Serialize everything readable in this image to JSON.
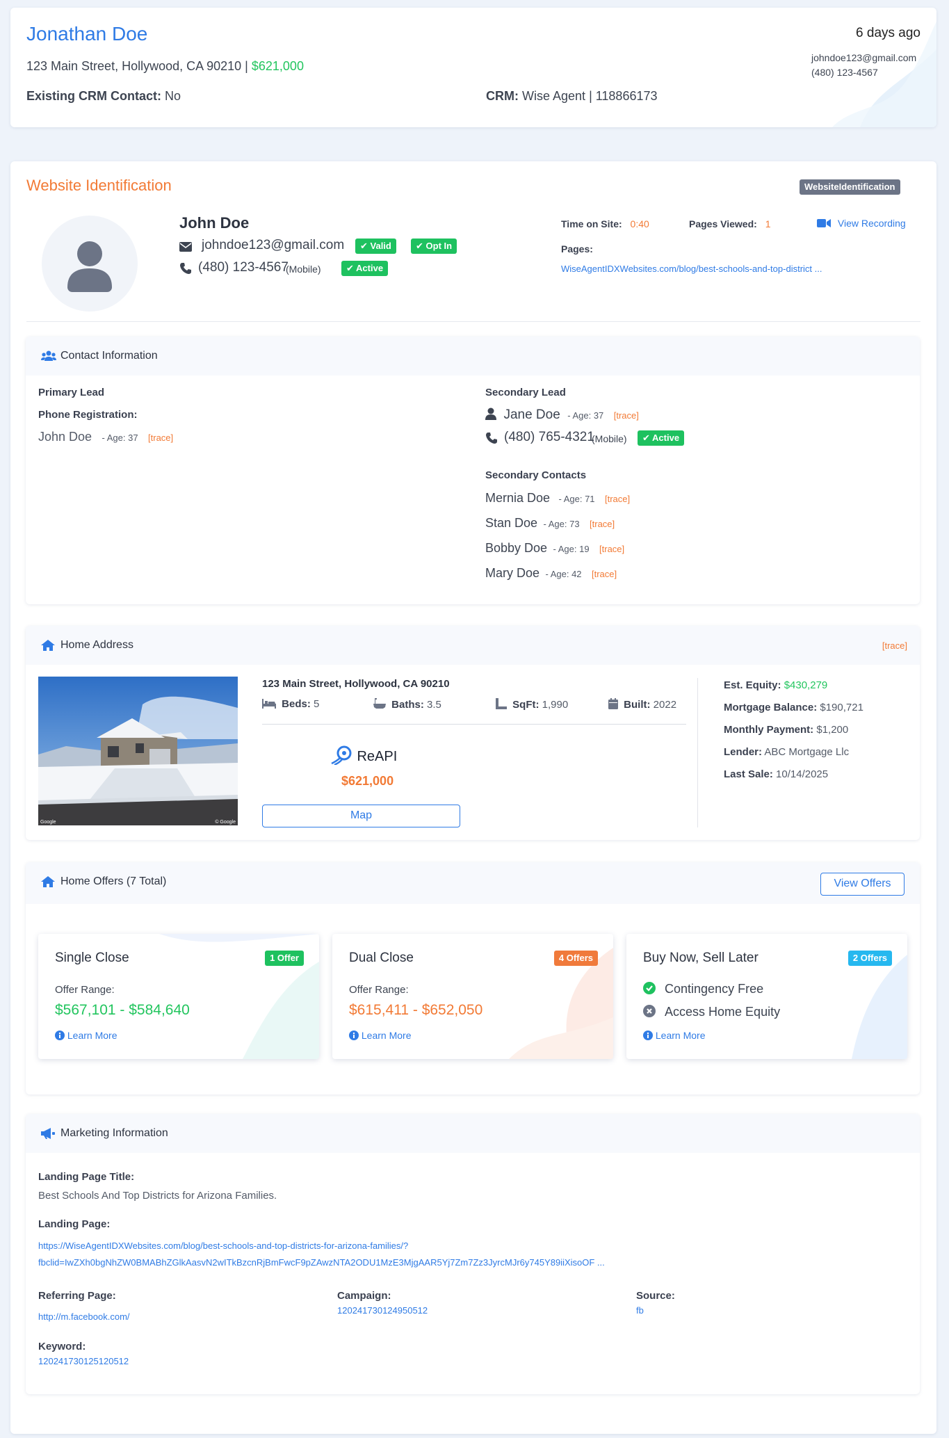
{
  "header": {
    "name": "Jonathan Doe",
    "address": "123 Main Street, Hollywood, CA 90210 |",
    "price": "$621,000",
    "existing_label": "Existing CRM Contact:",
    "existing_value": "No",
    "crm_label": "CRM:",
    "crm_value": "Wise Agent | 118866173",
    "time_ago": "6 days ago",
    "email": "johndoe123@gmail.com",
    "phone": "(480) 123-4567"
  },
  "website_identification": {
    "title": "Website Identification",
    "badge": "WebsiteIdentification",
    "person_name": "John Doe",
    "email": "johndoe123@gmail.com",
    "email_badges": [
      "Valid",
      "Opt In"
    ],
    "phone": "(480) 123-4567",
    "phone_type": "(Mobile)",
    "phone_badge": "Active",
    "time_on_site_label": "Time on Site:",
    "time_on_site": "0:40",
    "pages_viewed_label": "Pages Viewed:",
    "pages_viewed": "1",
    "view_recording": "View Recording",
    "pages_label": "Pages:",
    "page_url": "WiseAgentIDXWebsites.com/blog/best-schools-and-top-district ..."
  },
  "contact": {
    "title": "Contact Information",
    "primary_label": "Primary Lead",
    "phone_reg_label": "Phone Registration:",
    "primary_name": "John Doe",
    "primary_age": "- Age: 37",
    "trace": "[trace]",
    "secondary_label": "Secondary Lead",
    "secondary_name": "Jane Doe",
    "secondary_age": "- Age: 37",
    "secondary_phone": "(480) 765-4321",
    "secondary_phone_type": "(Mobile)",
    "secondary_phone_badge": "Active",
    "secondary_contacts_label": "Secondary Contacts",
    "secondary_contacts": [
      {
        "name": "Mernia Doe",
        "age": "- Age: 71"
      },
      {
        "name": "Stan Doe",
        "age": "- Age: 73"
      },
      {
        "name": "Bobby Doe",
        "age": "- Age: 19"
      },
      {
        "name": "Mary Doe",
        "age": "- Age: 42"
      }
    ]
  },
  "home": {
    "title": "Home Address",
    "trace": "[trace]",
    "address": "123 Main Street, Hollywood, CA 90210",
    "beds_label": "Beds:",
    "beds": "5",
    "baths_label": "Baths:",
    "baths": "3.5",
    "sqft_label": "SqFt:",
    "sqft": "1,990",
    "built_label": "Built:",
    "built": "2022",
    "reapi": "ReAPI",
    "value": "$621,000",
    "map_button": "Map",
    "equity_label": "Est. Equity:",
    "equity": "$430,279",
    "mortgage_label": "Mortgage Balance:",
    "mortgage": "$190,721",
    "monthly_label": "Monthly Payment:",
    "monthly": "$1,200",
    "lender_label": "Lender:",
    "lender": "ABC Mortgage Llc",
    "last_sale_label": "Last Sale:",
    "last_sale": "10/14/2025",
    "photo_caption_left": "Google",
    "photo_caption_right": "© Google"
  },
  "offers": {
    "title": "Home Offers (7 Total)",
    "view_button": "View Offers",
    "range_label": "Offer Range:",
    "learn_more": "Learn More",
    "cards": [
      {
        "title": "Single Close",
        "badge": "1 Offer",
        "range": "$567,101 - $584,640"
      },
      {
        "title": "Dual Close",
        "badge": "4 Offers",
        "range": "$615,411 - $652,050"
      },
      {
        "title": "Buy Now, Sell Later",
        "badge": "2 Offers",
        "features": [
          "Contingency Free",
          "Access Home Equity"
        ]
      }
    ]
  },
  "marketing": {
    "title": "Marketing Information",
    "landing_title_label": "Landing Page Title:",
    "landing_title": "Best Schools And Top Districts for Arizona Families.",
    "landing_page_label": "Landing Page:",
    "landing_url_1": "https://WiseAgentIDXWebsites.com/blog/best-schools-and-top-districts-for-arizona-families/?",
    "landing_url_2": "fbclid=IwZXh0bgNhZW0BMABhZGlkAasvN2wITkBzcnRjBmFwcF9pZAwzNTA2ODU1MzE3MjgAAR5Yj7Zm7Zz3JyrcMJr6y745Y89iiXisoOF ...",
    "referring_label": "Referring Page:",
    "referring": "http://m.facebook.com/",
    "campaign_label": "Campaign:",
    "campaign": "120241730124950512",
    "source_label": "Source:",
    "source": "fb",
    "keyword_label": "Keyword:",
    "keyword": "120241730125120512"
  }
}
